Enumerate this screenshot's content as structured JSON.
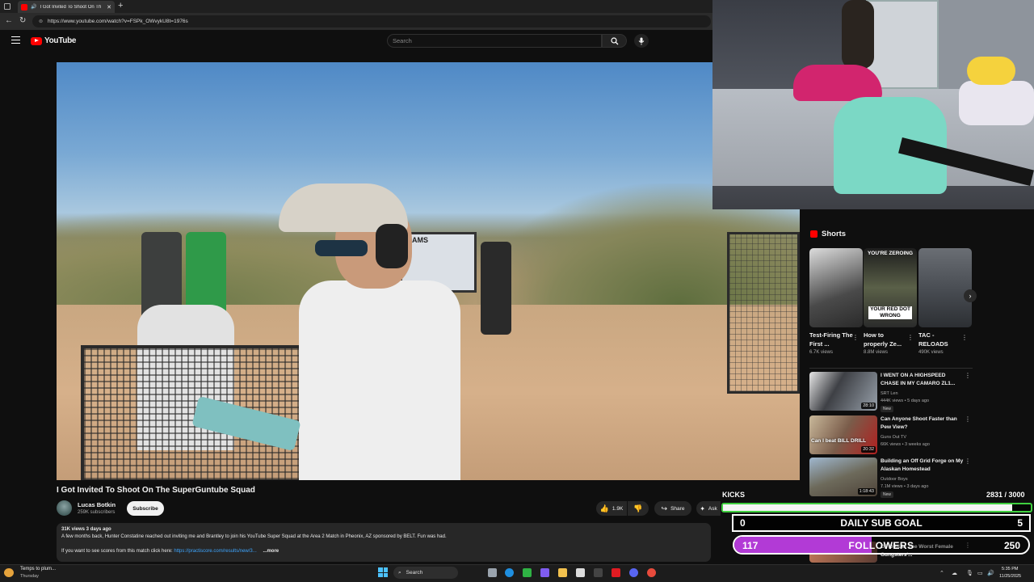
{
  "browser": {
    "tab_title": "I Got Invited To Shoot On Th",
    "url": "https://www.youtube.com/watch?v=FSPk_OWvykU8t=1976s",
    "new_tab": "+"
  },
  "header": {
    "logo": "YouTube",
    "search_placeholder": "Search"
  },
  "video": {
    "title": "I Got Invited To Shoot On The SuperGuntube Squad",
    "channel": "Lucas Botkin",
    "subscribers": "259K subscribers",
    "subscribe_label": "Subscribe",
    "likes": "1.9K",
    "share_label": "Share",
    "ask_label": "Ask",
    "sign_text": "AMS",
    "description": {
      "meta": "31K views  3 days ago",
      "line1": "A few months back, Hunter Constatine reached out inviting me and Brantley to join his YouTube Super Squad at the Area 2 Match in Pheonix, AZ sponsored by BELT. Fun was had.",
      "line2_prefix": "If you want to see scores from this match click here:",
      "link": "https://practiscore.com/results/new/3...",
      "more": "...more"
    }
  },
  "shorts": {
    "heading": "Shorts",
    "items": [
      {
        "title": "Test-Firing The First ...",
        "views": "6.7K views",
        "overlay": ""
      },
      {
        "title": "How to properly Ze...",
        "views": "8.8M views",
        "overlay_top": "YOU'RE ZEROING",
        "overlay_bottom": "YOUR RED DOT WRONG"
      },
      {
        "title": "TAC - RELOADS",
        "views": "490K views",
        "overlay": ""
      }
    ]
  },
  "recommended": [
    {
      "title": "I WENT ON A HIGHSPEED CHASE IN MY CAMARO ZL1...",
      "channel": "SRT Len",
      "meta": "444K views • 5 days ago",
      "duration": "28:10",
      "badge": "New"
    },
    {
      "title": "Can Anyone Shoot Faster than Pew View?",
      "channel": "Guns Out TV",
      "meta": "66K views • 3 weeks ago",
      "duration": "20:32",
      "thumb_text": "Can I beat BILL DRILL"
    },
    {
      "title": "Building an Off Grid Forge on My Alaskan Homestead",
      "channel": "Outdoor Boys",
      "meta": "7.1M views • 3 days ago",
      "duration": "1:18:43",
      "badge": "New"
    },
    {
      "title": "OF DRILL! The Worst Female Gungsters'...",
      "channel": "",
      "meta": "",
      "duration": ""
    }
  ],
  "stream": {
    "kicks_label": "KICKS",
    "kicks_count": "2831  / 3000",
    "kicks_progress": 0.94,
    "sub_goal_current": "0",
    "sub_goal_label": "DAILY SUB GOAL",
    "sub_goal_target": "5",
    "followers_current": "117",
    "followers_label": "FOLLOWERS",
    "followers_target": "250",
    "followers_progress": 0.468
  },
  "taskbar": {
    "weather_line1": "Temps to plum...",
    "weather_line2": "Thursday",
    "search_label": "Search",
    "time": "5:35 PM",
    "date": "11/25/2025"
  },
  "colors": {
    "accent_red": "#ff0000",
    "kicks_border": "#3fcf3f",
    "followers_fill": "#b23ad6",
    "link": "#3ea6ff"
  }
}
